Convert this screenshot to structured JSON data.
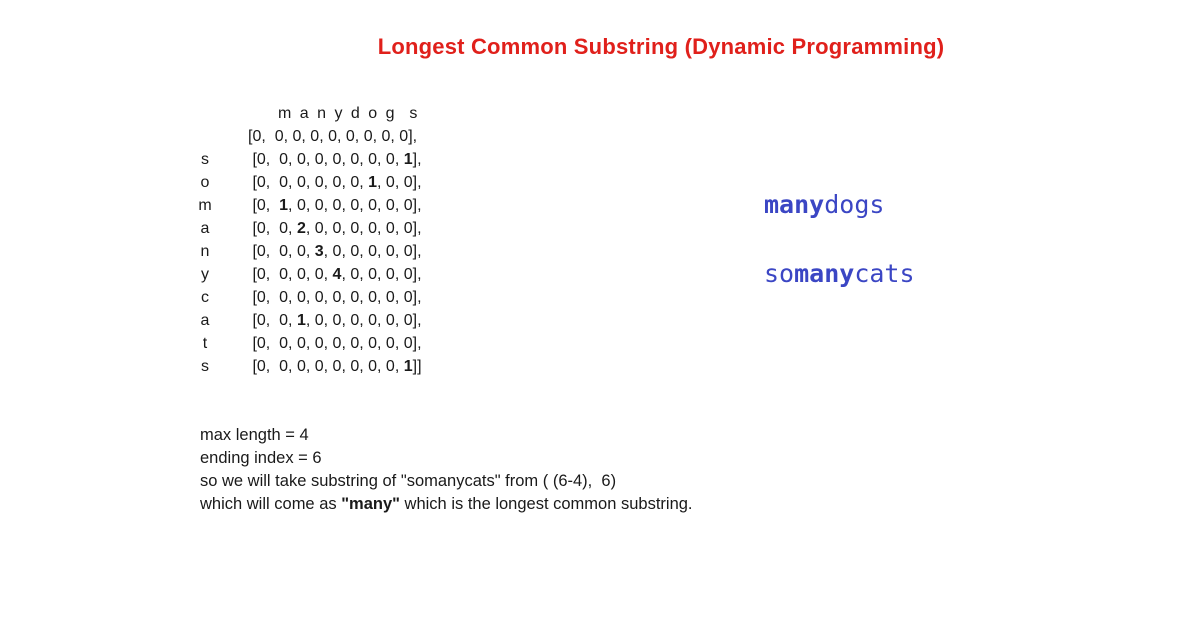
{
  "title": "Longest Common Substring (Dynamic Programming)",
  "matrix": {
    "column_header": "m a n y d o g  s",
    "row_labels": [
      "",
      "s",
      "o",
      "m",
      "a",
      "n",
      "y",
      "c",
      "a",
      "t",
      "s"
    ],
    "rows": [
      [
        0,
        0,
        0,
        0,
        0,
        0,
        0,
        0,
        0
      ],
      [
        0,
        0,
        0,
        0,
        0,
        0,
        0,
        0,
        1
      ],
      [
        0,
        0,
        0,
        0,
        0,
        0,
        1,
        0,
        0
      ],
      [
        0,
        1,
        0,
        0,
        0,
        0,
        0,
        0,
        0
      ],
      [
        0,
        0,
        2,
        0,
        0,
        0,
        0,
        0,
        0
      ],
      [
        0,
        0,
        0,
        3,
        0,
        0,
        0,
        0,
        0
      ],
      [
        0,
        0,
        0,
        0,
        4,
        0,
        0,
        0,
        0
      ],
      [
        0,
        0,
        0,
        0,
        0,
        0,
        0,
        0,
        0
      ],
      [
        0,
        0,
        1,
        0,
        0,
        0,
        0,
        0,
        0
      ],
      [
        0,
        0,
        0,
        0,
        0,
        0,
        0,
        0,
        0
      ],
      [
        0,
        0,
        0,
        0,
        0,
        0,
        0,
        0,
        1
      ]
    ]
  },
  "notes": {
    "line1": "max length = 4",
    "line2": "ending index = 6",
    "line3": "so we will take substring of \"somanycats\" from ( (6-4),  6)",
    "line4_prefix": "which will come as ",
    "line4_bold": "\"many\"",
    "line4_suffix": " which is the longest common substring."
  },
  "words": {
    "word1_bold": "many",
    "word1_rest": "dogs",
    "word2_pre": "so",
    "word2_bold": "many",
    "word2_rest": "cats"
  },
  "colors": {
    "title": "#e0201b",
    "words": "#3b46c4"
  }
}
